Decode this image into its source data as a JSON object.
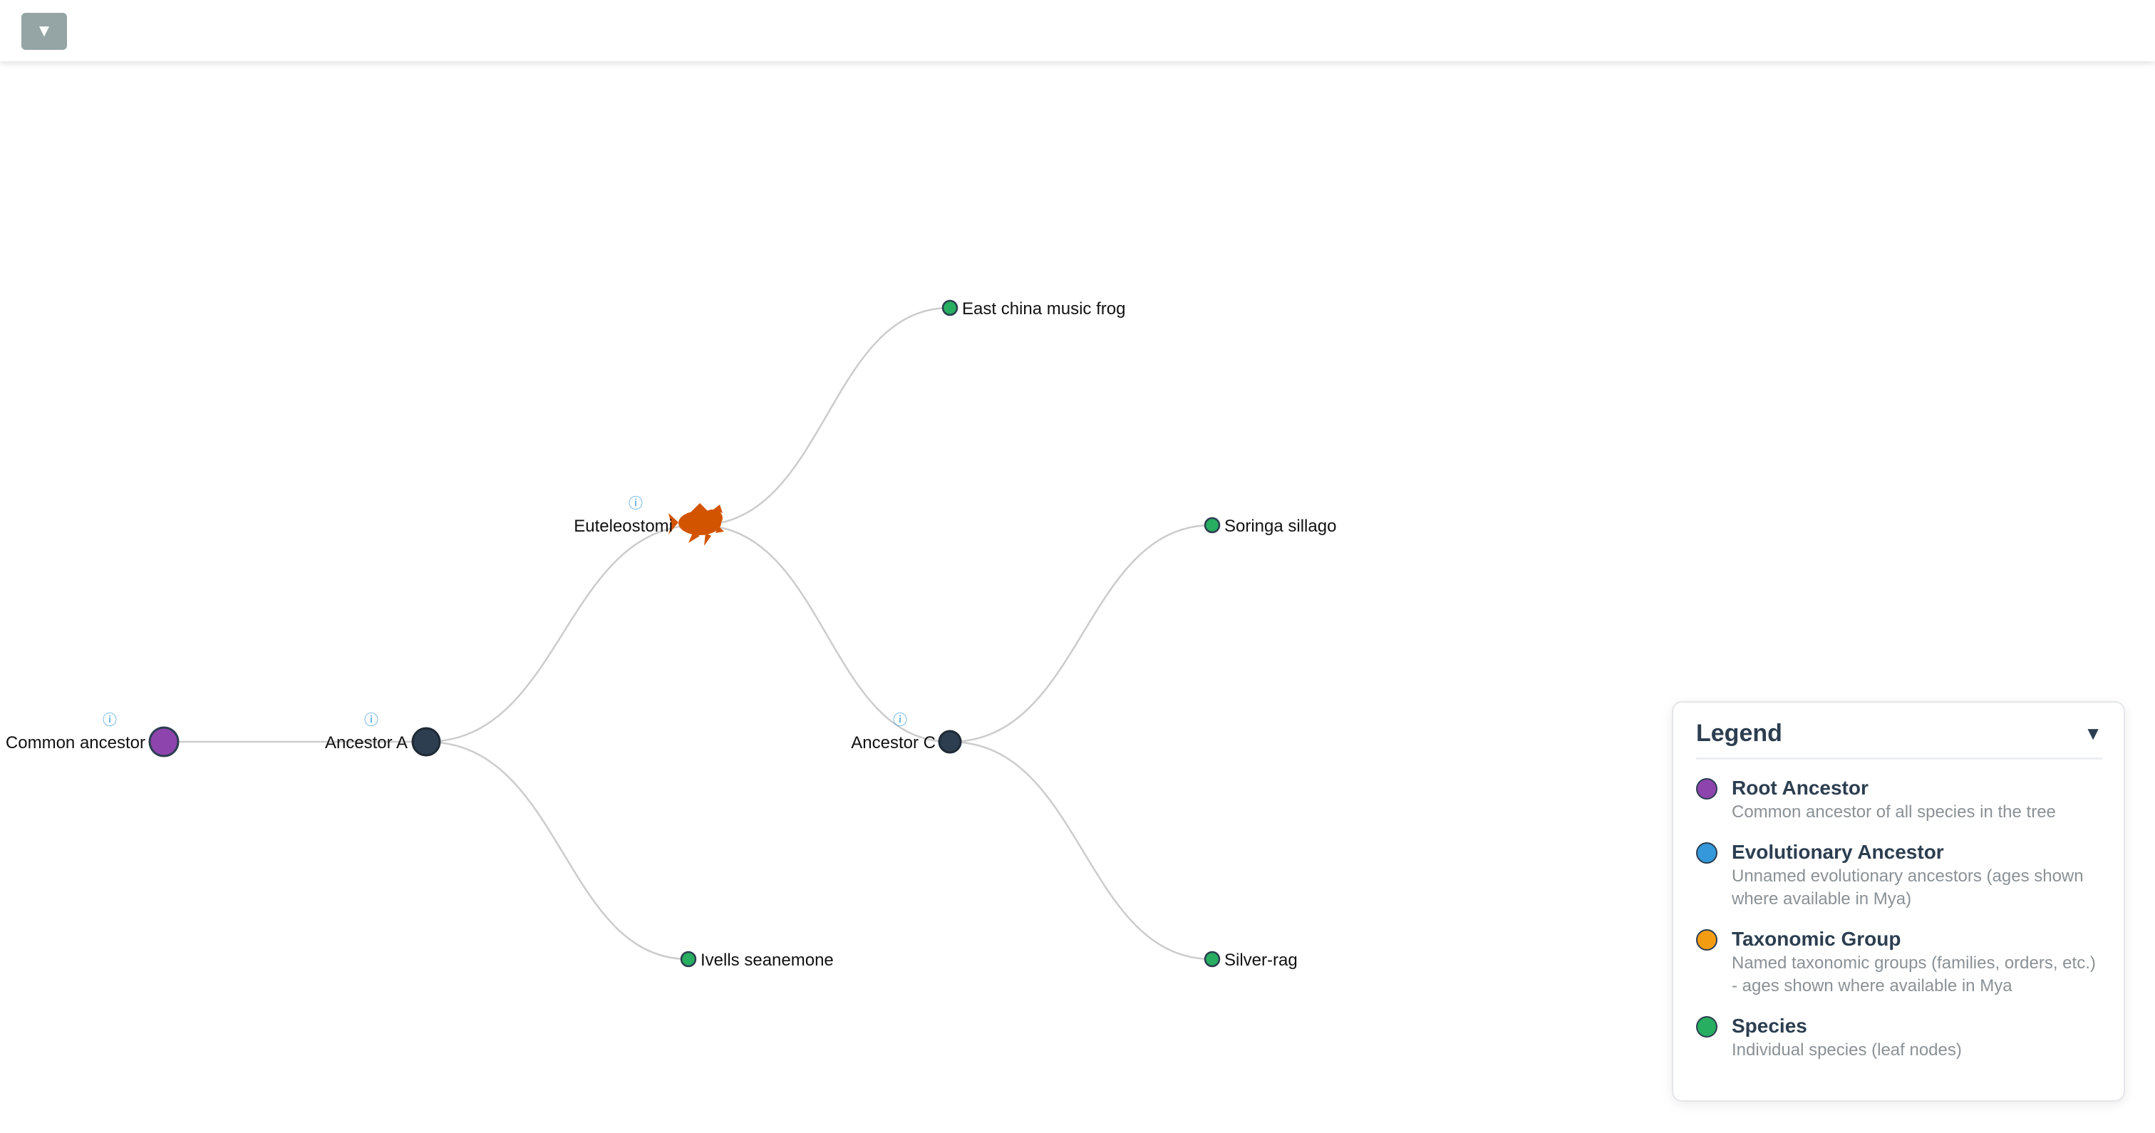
{
  "toolbar": {
    "menu_toggle_label": "▼"
  },
  "tree": {
    "nodes": {
      "common_ancestor": {
        "label": "Common ancestor",
        "type": "root",
        "has_info": true
      },
      "ancestor_a": {
        "label": "Ancestor A",
        "type": "ancestor",
        "has_info": true
      },
      "euteleostomi": {
        "label": "Euteleostomi",
        "type": "taxonomic-group",
        "icon": "fish-silhouette-icon",
        "has_info": true
      },
      "ancestor_c": {
        "label": "Ancestor C",
        "type": "ancestor",
        "has_info": true
      },
      "east_china_music_frog": {
        "label": "East china music frog",
        "type": "species"
      },
      "soringa_sillago": {
        "label": "Soringa sillago",
        "type": "species"
      },
      "ivells_seanemone": {
        "label": "Ivells seanemone",
        "type": "species"
      },
      "silver_rag": {
        "label": "Silver-rag",
        "type": "species"
      }
    },
    "info_icon_glyph": "ⓘ"
  },
  "legend": {
    "title": "Legend",
    "toggle": "▼",
    "items": [
      {
        "label": "Root Ancestor",
        "description": "Common ancestor of all species in the tree",
        "color": "#8e44ad"
      },
      {
        "label": "Evolutionary Ancestor",
        "description": "Unnamed evolutionary ancestors (ages shown where available in Mya)",
        "color": "#3498db"
      },
      {
        "label": "Taxonomic Group",
        "description": "Named taxonomic groups (families, orders, etc.) - ages shown where available in Mya",
        "color": "#f39c12"
      },
      {
        "label": "Species",
        "description": "Individual species (leaf nodes)",
        "color": "#27ae60"
      }
    ]
  },
  "colors": {
    "root": "#8e44ad",
    "ancestor_node": "#2c3e50",
    "species": "#27ae60",
    "taxon_icon": "#d35400",
    "link": "#cccccc",
    "info": "#3498db"
  }
}
